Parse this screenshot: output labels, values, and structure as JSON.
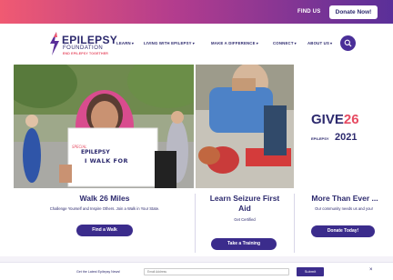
{
  "topbar": {
    "find_us": "FIND US",
    "donate": "Donate Now!"
  },
  "logo": {
    "line1": "EPILEPSY",
    "line2": "FOUNDATION",
    "line3": "END EPILEPSY TOGETHER"
  },
  "nav": [
    {
      "label": "LEARN"
    },
    {
      "label": "LIVING WITH EPILEPSY"
    },
    {
      "label": "MAKE A DIFFERENCE"
    },
    {
      "label": "CONNECT"
    },
    {
      "label": "ABOUT US"
    }
  ],
  "hero": {
    "sign": {
      "line1": "SPECIAL",
      "line2": "EPILEPSY",
      "line3": "I WALK FOR"
    },
    "give": {
      "word": "GIVE",
      "number": "26",
      "brand": "EPILEPSY",
      "year": "2021"
    }
  },
  "columns": [
    {
      "title": "Walk 26 Miles",
      "subtitle": "Challenge Yourself and Inspire Others. Join a Walk in Your State.",
      "button": "Find a Walk"
    },
    {
      "title": "Learn Seizure First Aid",
      "subtitle": "Get Certified",
      "button": "Take a Training"
    },
    {
      "title": "More Than Ever ...",
      "subtitle": "Our community needs us and you!",
      "button": "Donate Today!"
    }
  ],
  "newsletter": {
    "label": "Get the Latest Epilepsy News!",
    "placeholder": "Email Address",
    "submit": "Submit",
    "close": "×"
  },
  "colors": {
    "navy": "#2d2a6e",
    "purple": "#3b2c8c",
    "pink": "#f05a72",
    "accent_red": "#e64b62"
  }
}
